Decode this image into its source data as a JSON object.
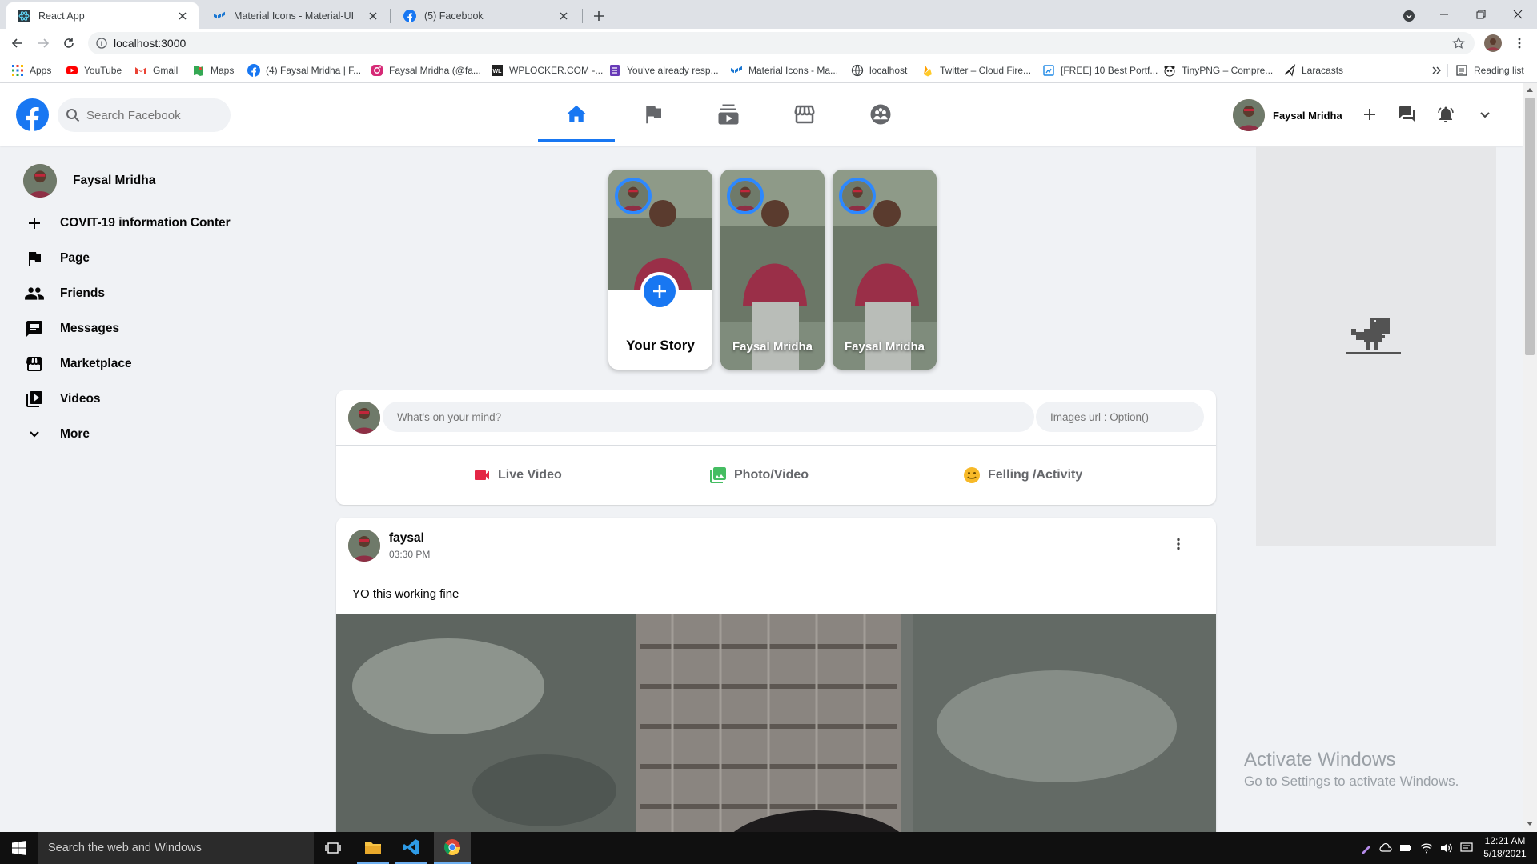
{
  "browser": {
    "tabs": [
      {
        "title": "React App",
        "active": true
      },
      {
        "title": "Material Icons - Material-UI",
        "active": false
      },
      {
        "title": "(5) Facebook",
        "active": false
      }
    ],
    "url": "localhost:3000",
    "bookmarks": [
      {
        "label": "Apps",
        "icon": "apps-grid-icon"
      },
      {
        "label": "YouTube",
        "icon": "youtube-icon"
      },
      {
        "label": "Gmail",
        "icon": "gmail-icon"
      },
      {
        "label": "Maps",
        "icon": "maps-icon"
      },
      {
        "label": "(4) Faysal Mridha | F...",
        "icon": "facebook-icon"
      },
      {
        "label": "Faysal Mridha (@fa...",
        "icon": "instagram-icon"
      },
      {
        "label": "WPLOCKER.COM -...",
        "icon": "wplocker-icon"
      },
      {
        "label": "You've already resp...",
        "icon": "forms-icon"
      },
      {
        "label": "Material Icons - Ma...",
        "icon": "material-ui-icon"
      },
      {
        "label": "localhost",
        "icon": "globe-icon"
      },
      {
        "label": "Twitter – Cloud Fire...",
        "icon": "firebase-icon"
      },
      {
        "label": "[FREE] 10 Best Portf...",
        "icon": "bookmark-page-icon"
      },
      {
        "label": "TinyPNG – Compre...",
        "icon": "panda-icon"
      },
      {
        "label": "Laracasts",
        "icon": "laracasts-icon"
      }
    ],
    "reading_list": "Reading list"
  },
  "fb": {
    "search_placeholder": "Search Facebook",
    "user_name": "Faysal Mridha",
    "nav_tabs": [
      "home-icon",
      "flag-icon",
      "subscriptions-icon",
      "storefront-icon",
      "groups-icon"
    ],
    "brand_color": "#1877f2"
  },
  "sidebar": {
    "user_name": "Faysal Mridha",
    "items": [
      {
        "label": "COVIT-19 information Conter",
        "icon": "plus-icon"
      },
      {
        "label": "Page",
        "icon": "flag-icon"
      },
      {
        "label": "Friends",
        "icon": "people-icon"
      },
      {
        "label": "Messages",
        "icon": "chat-icon"
      },
      {
        "label": "Marketplace",
        "icon": "storefront-icon"
      },
      {
        "label": "Videos",
        "icon": "video-library-icon"
      },
      {
        "label": "More",
        "icon": "expand-more-icon"
      }
    ]
  },
  "stories": [
    {
      "name": "Your Story"
    },
    {
      "name": "Faysal Mridha"
    },
    {
      "name": "Faysal Mridha"
    }
  ],
  "composer": {
    "message_placeholder": "What's on your mind?",
    "image_placeholder": "Images url : Option()",
    "actions": [
      {
        "label": "Live Video",
        "color": "#e42645"
      },
      {
        "label": "Photo/Video",
        "color": "#45bd62"
      },
      {
        "label": "Felling /Activity",
        "color": "#f7b928"
      }
    ]
  },
  "post": {
    "author": "faysal",
    "time": "03:30 PM",
    "text": "YO this working fine"
  },
  "watermark": {
    "title": "Activate Windows",
    "subtitle": "Go to Settings to activate Windows."
  },
  "taskbar": {
    "search_placeholder": "Search the web and Windows",
    "time": "12:21 AM",
    "date": "5/18/2021"
  }
}
